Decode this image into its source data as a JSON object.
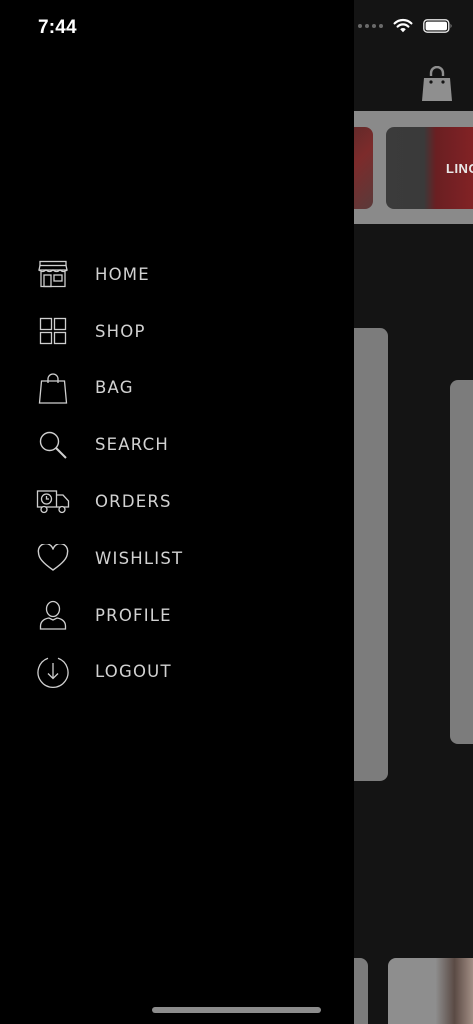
{
  "status_bar": {
    "time": "7:44"
  },
  "background": {
    "category_label": "LING"
  },
  "drawer": {
    "menu": [
      {
        "label": "HOME",
        "icon": "store-icon"
      },
      {
        "label": "SHOP",
        "icon": "grid-icon"
      },
      {
        "label": "BAG",
        "icon": "bag-icon"
      },
      {
        "label": "SEARCH",
        "icon": "search-icon"
      },
      {
        "label": "ORDERS",
        "icon": "delivery-truck-icon"
      },
      {
        "label": "WISHLIST",
        "icon": "heart-icon"
      },
      {
        "label": "PROFILE",
        "icon": "user-icon"
      },
      {
        "label": "LOGOUT",
        "icon": "logout-arrow-icon"
      }
    ]
  },
  "colors": {
    "drawer_bg": "#000000",
    "menu_text": "#d2d2d2",
    "icon_stroke": "#cfcfcf",
    "overlay_bg": "#141414"
  }
}
